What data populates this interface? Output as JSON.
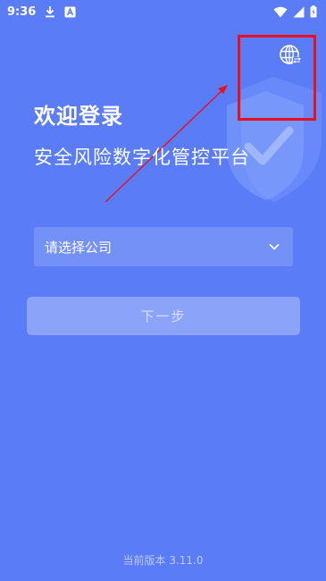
{
  "status_bar": {
    "time": "9:36",
    "icons": [
      "download-icon",
      "a-badge-icon",
      "wifi-icon",
      "signal-icon",
      "battery-icon"
    ]
  },
  "header": {
    "language_icon": "globe-icon"
  },
  "login": {
    "welcome": "欢迎登录",
    "platform_name": "安全风险数字化管控平台",
    "company_placeholder": "请选择公司",
    "next_button": "下一步"
  },
  "footer": {
    "version": "当前版本 3.11.0"
  },
  "colors": {
    "background": "#5a7cf7",
    "annotation": "#e8111b"
  }
}
